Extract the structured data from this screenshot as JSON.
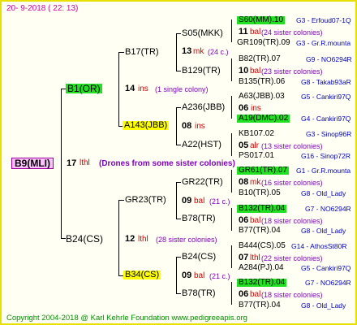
{
  "header": "20-  9-2018 ( 22: 13)",
  "footer": "Copyright 2004-2018 @ Karl Kehrle Foundation    www.pedigreeapis.org",
  "root": {
    "name": "B9(MLI)",
    "num": "17",
    "ins": "lthl",
    "note": "(Drones from some sister colonies)"
  },
  "gen1": {
    "top": {
      "name": "B1(OR)",
      "num": "14",
      "ins": "ins",
      "note": "(1 single colony)"
    },
    "bottom": {
      "name": "B24(CS)",
      "num": "12",
      "ins": "lthl",
      "note": "(28 sister colonies)"
    }
  },
  "gen2": {
    "b17": {
      "name": "B17(TR)"
    },
    "a143": {
      "name": "A143(JBB)",
      "num": "08",
      "ins": "ins"
    },
    "gr23": {
      "name": "GR23(TR)",
      "num": "09",
      "ins": "bal",
      "note": "(21 c.)"
    },
    "b34": {
      "name": "B34(CS)",
      "num": "09",
      "ins": "bal",
      "note": "(21 c.)"
    }
  },
  "gen3": {
    "s05": {
      "name": "S05(MKK)",
      "num": "13",
      "ins": "mk",
      "note": "(24 c.)"
    },
    "b129": {
      "name": "B129(TR)",
      "num": "10",
      "ins": "bal",
      "note": "(23 sister colonies)"
    },
    "a236": {
      "name": "A236(JBB)",
      "num": "06",
      "ins": "ins"
    },
    "a22": {
      "name": "A22(HST)",
      "num": "05",
      "ins": "alr",
      "note": "(13 sister colonies)"
    },
    "gr22": {
      "name": "GR22(TR)",
      "num": "08",
      "ins": "mk",
      "note": "(16 sister colonies)"
    },
    "b78a": {
      "name": "B78(TR)",
      "num": "06",
      "ins": "bal",
      "note": "(18 sister colonies)"
    },
    "b24b": {
      "name": "B24(CS)",
      "num": "07",
      "ins": "lthl",
      "note": "(22 sister colonies)"
    },
    "b78b": {
      "name": "B78(TR)",
      "num": "06",
      "ins": "bal",
      "note": "(18 sister colonies)"
    }
  },
  "gen3_mid": {
    "s05": {
      "num": "11",
      "ins": "bal",
      "note": "(24 sister colonies)"
    },
    "a143": {
      "num": "06",
      "ins": "ins"
    }
  },
  "gen4": [
    {
      "name": "S60(MM).10",
      "code": "G3 - Erfoud07-1Q"
    },
    {
      "name": "GR109(TR).09",
      "code": "G3 - Gr.R.mounta"
    },
    {
      "name": "B82(TR).07",
      "code": "G9 - NO6294R"
    },
    {
      "name": "B135(TR).06",
      "code": "G8 - Takab93aR"
    },
    {
      "name": "A63(JBB).03",
      "code": "G5 - Cankiri97Q"
    },
    {
      "name": "A19(DMC).02",
      "code": "G4 - Cankiri97Q"
    },
    {
      "name": "KB107.02",
      "code": "G3 - Sinop96R"
    },
    {
      "name": "PS017.01",
      "code": "G16 - Sinop72R"
    },
    {
      "name": "GR61(TR).07",
      "code": "G1 - Gr.R.mounta"
    },
    {
      "name": "B10(TR).05",
      "code": "G8 - Old_Lady"
    },
    {
      "name": "B132(TR).04",
      "code": "G7 - NO6294R"
    },
    {
      "name": "B77(TR).04",
      "code": "G8 - Old_Lady"
    },
    {
      "name": "B444(CS).05",
      "code": "G14 - AthosSt80R"
    },
    {
      "name": "A284(PJ).04",
      "code": "G5 - Cankiri97Q"
    },
    {
      "name": "B132(TR).04",
      "code": "G7 - NO6294R"
    },
    {
      "name": "B77(TR).04",
      "code": "G8 - Old_Lady"
    }
  ],
  "colors": {
    "border": "#e8e000",
    "highlight_green": "#22e022",
    "highlight_yellow": "#ffff00",
    "highlight_pink": "#ffc0ff",
    "footer": "#009000"
  }
}
